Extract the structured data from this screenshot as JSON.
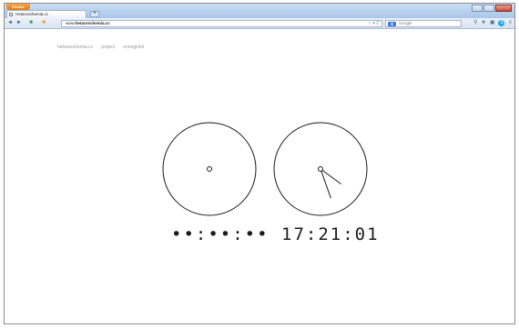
{
  "window": {
    "app_button": "Firefox",
    "tab_title": "Hetaroschemia.cc",
    "new_tab": "+"
  },
  "navbar": {
    "back": "◄",
    "forward": "►",
    "url_prefix": "www.",
    "url_host": "hetaroschemia.cc",
    "reload": "☆ ▾ C",
    "search_engine": "8",
    "search_placeholder": "Google"
  },
  "page": {
    "nav": [
      "hetaroschemia.cc",
      "project",
      "ennoglobit"
    ]
  },
  "clocks": {
    "left_digital": "••:••:••",
    "right_digital": "17:21:01",
    "time": {
      "hours": 17,
      "minutes": 21,
      "seconds": 1
    }
  },
  "colors": {
    "tab_bar": "#aac6ea",
    "app_button": "#f08a2a",
    "clock_stroke": "#1a1a1a"
  }
}
